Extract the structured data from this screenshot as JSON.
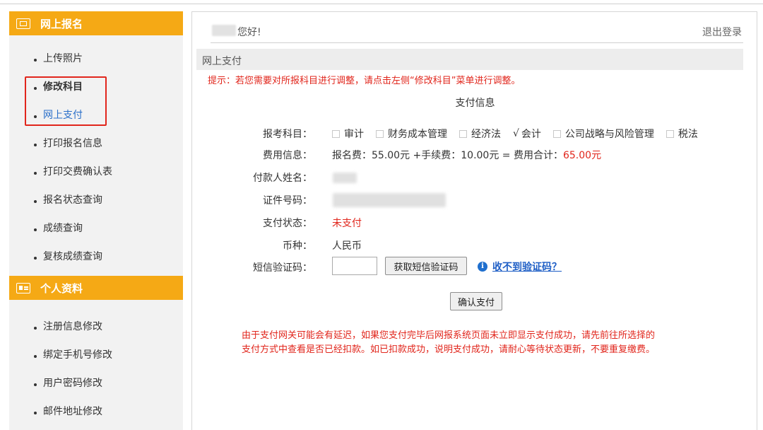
{
  "sidebar": {
    "section1_title": "网上报名",
    "section1_items": [
      {
        "label": "上传照片"
      },
      {
        "label": "修改科目"
      },
      {
        "label": "网上支付"
      },
      {
        "label": "打印报名信息"
      },
      {
        "label": "打印交费确认表"
      },
      {
        "label": "报名状态查询"
      },
      {
        "label": "成绩查询"
      },
      {
        "label": "复核成绩查询"
      }
    ],
    "section2_title": "个人资料",
    "section2_items": [
      {
        "label": "注册信息修改"
      },
      {
        "label": "绑定手机号修改"
      },
      {
        "label": "用户密码修改"
      },
      {
        "label": "邮件地址修改"
      }
    ],
    "header_color": "#f5a915",
    "highlight_color": "#e1261c"
  },
  "header": {
    "greeting": "您好!",
    "logout": "退出登录"
  },
  "page": {
    "section_title": "网上支付",
    "tip": "提示：若您需要对所报科目进行调整，请点击左侧“修改科目”菜单进行调整。",
    "info_title": "支付信息"
  },
  "form": {
    "subjects_label": "报考科目：",
    "subjects": [
      {
        "name": "审计",
        "checked": false
      },
      {
        "name": "财务成本管理",
        "checked": false
      },
      {
        "name": "经济法",
        "checked": false
      },
      {
        "name": "会计",
        "checked": true
      },
      {
        "name": "公司战略与风险管理",
        "checked": false
      },
      {
        "name": "税法",
        "checked": false
      }
    ],
    "fee_label": "费用信息：",
    "fee_text": "报名费：55.00元 +手续费：10.00元 = 费用合计：",
    "fee_total": "65.00元",
    "payer_label": "付款人姓名：",
    "id_label": "证件号码：",
    "status_label": "支付状态：",
    "status_value": "未支付",
    "currency_label": "币种：",
    "currency_value": "人民币",
    "sms_label": "短信验证码：",
    "sms_button": "获取短信验证码",
    "no_code_link": "收不到验证码？",
    "confirm_button": "确认支付"
  },
  "notice": {
    "line1": "由于支付网关可能会有延迟，如果您支付完毕后网报系统页面未立即显示支付成功，请先前往所选择的",
    "line2": "支付方式中查看是否已经扣款。如已扣款成功，说明支付成功，请耐心等待状态更新，不要重复缴费。"
  }
}
